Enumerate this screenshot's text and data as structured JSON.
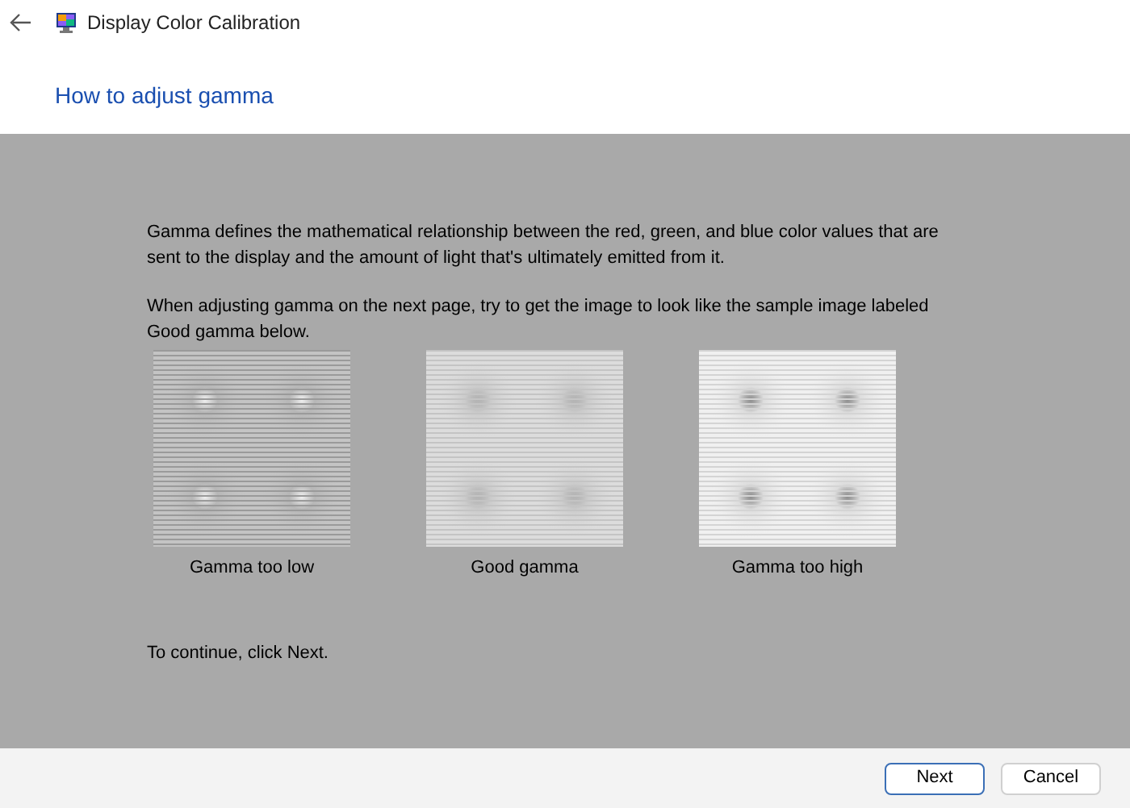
{
  "window": {
    "title": "Display Color Calibration"
  },
  "heading": "How to adjust gamma",
  "paragraphs": [
    "Gamma defines the mathematical relationship between the red, green, and blue color values that are sent to the display and the amount of light that's ultimately emitted from it.",
    "When adjusting gamma on the next page, try to get the image to look like the sample image labeled Good gamma below."
  ],
  "samples": [
    {
      "kind": "low",
      "label": "Gamma too low"
    },
    {
      "kind": "good",
      "label": "Good gamma"
    },
    {
      "kind": "high",
      "label": "Gamma too high"
    }
  ],
  "instruction": "To continue, click Next.",
  "buttons": [
    {
      "label": "Next",
      "selected": true
    },
    {
      "label": "Cancel",
      "selected": false
    }
  ]
}
